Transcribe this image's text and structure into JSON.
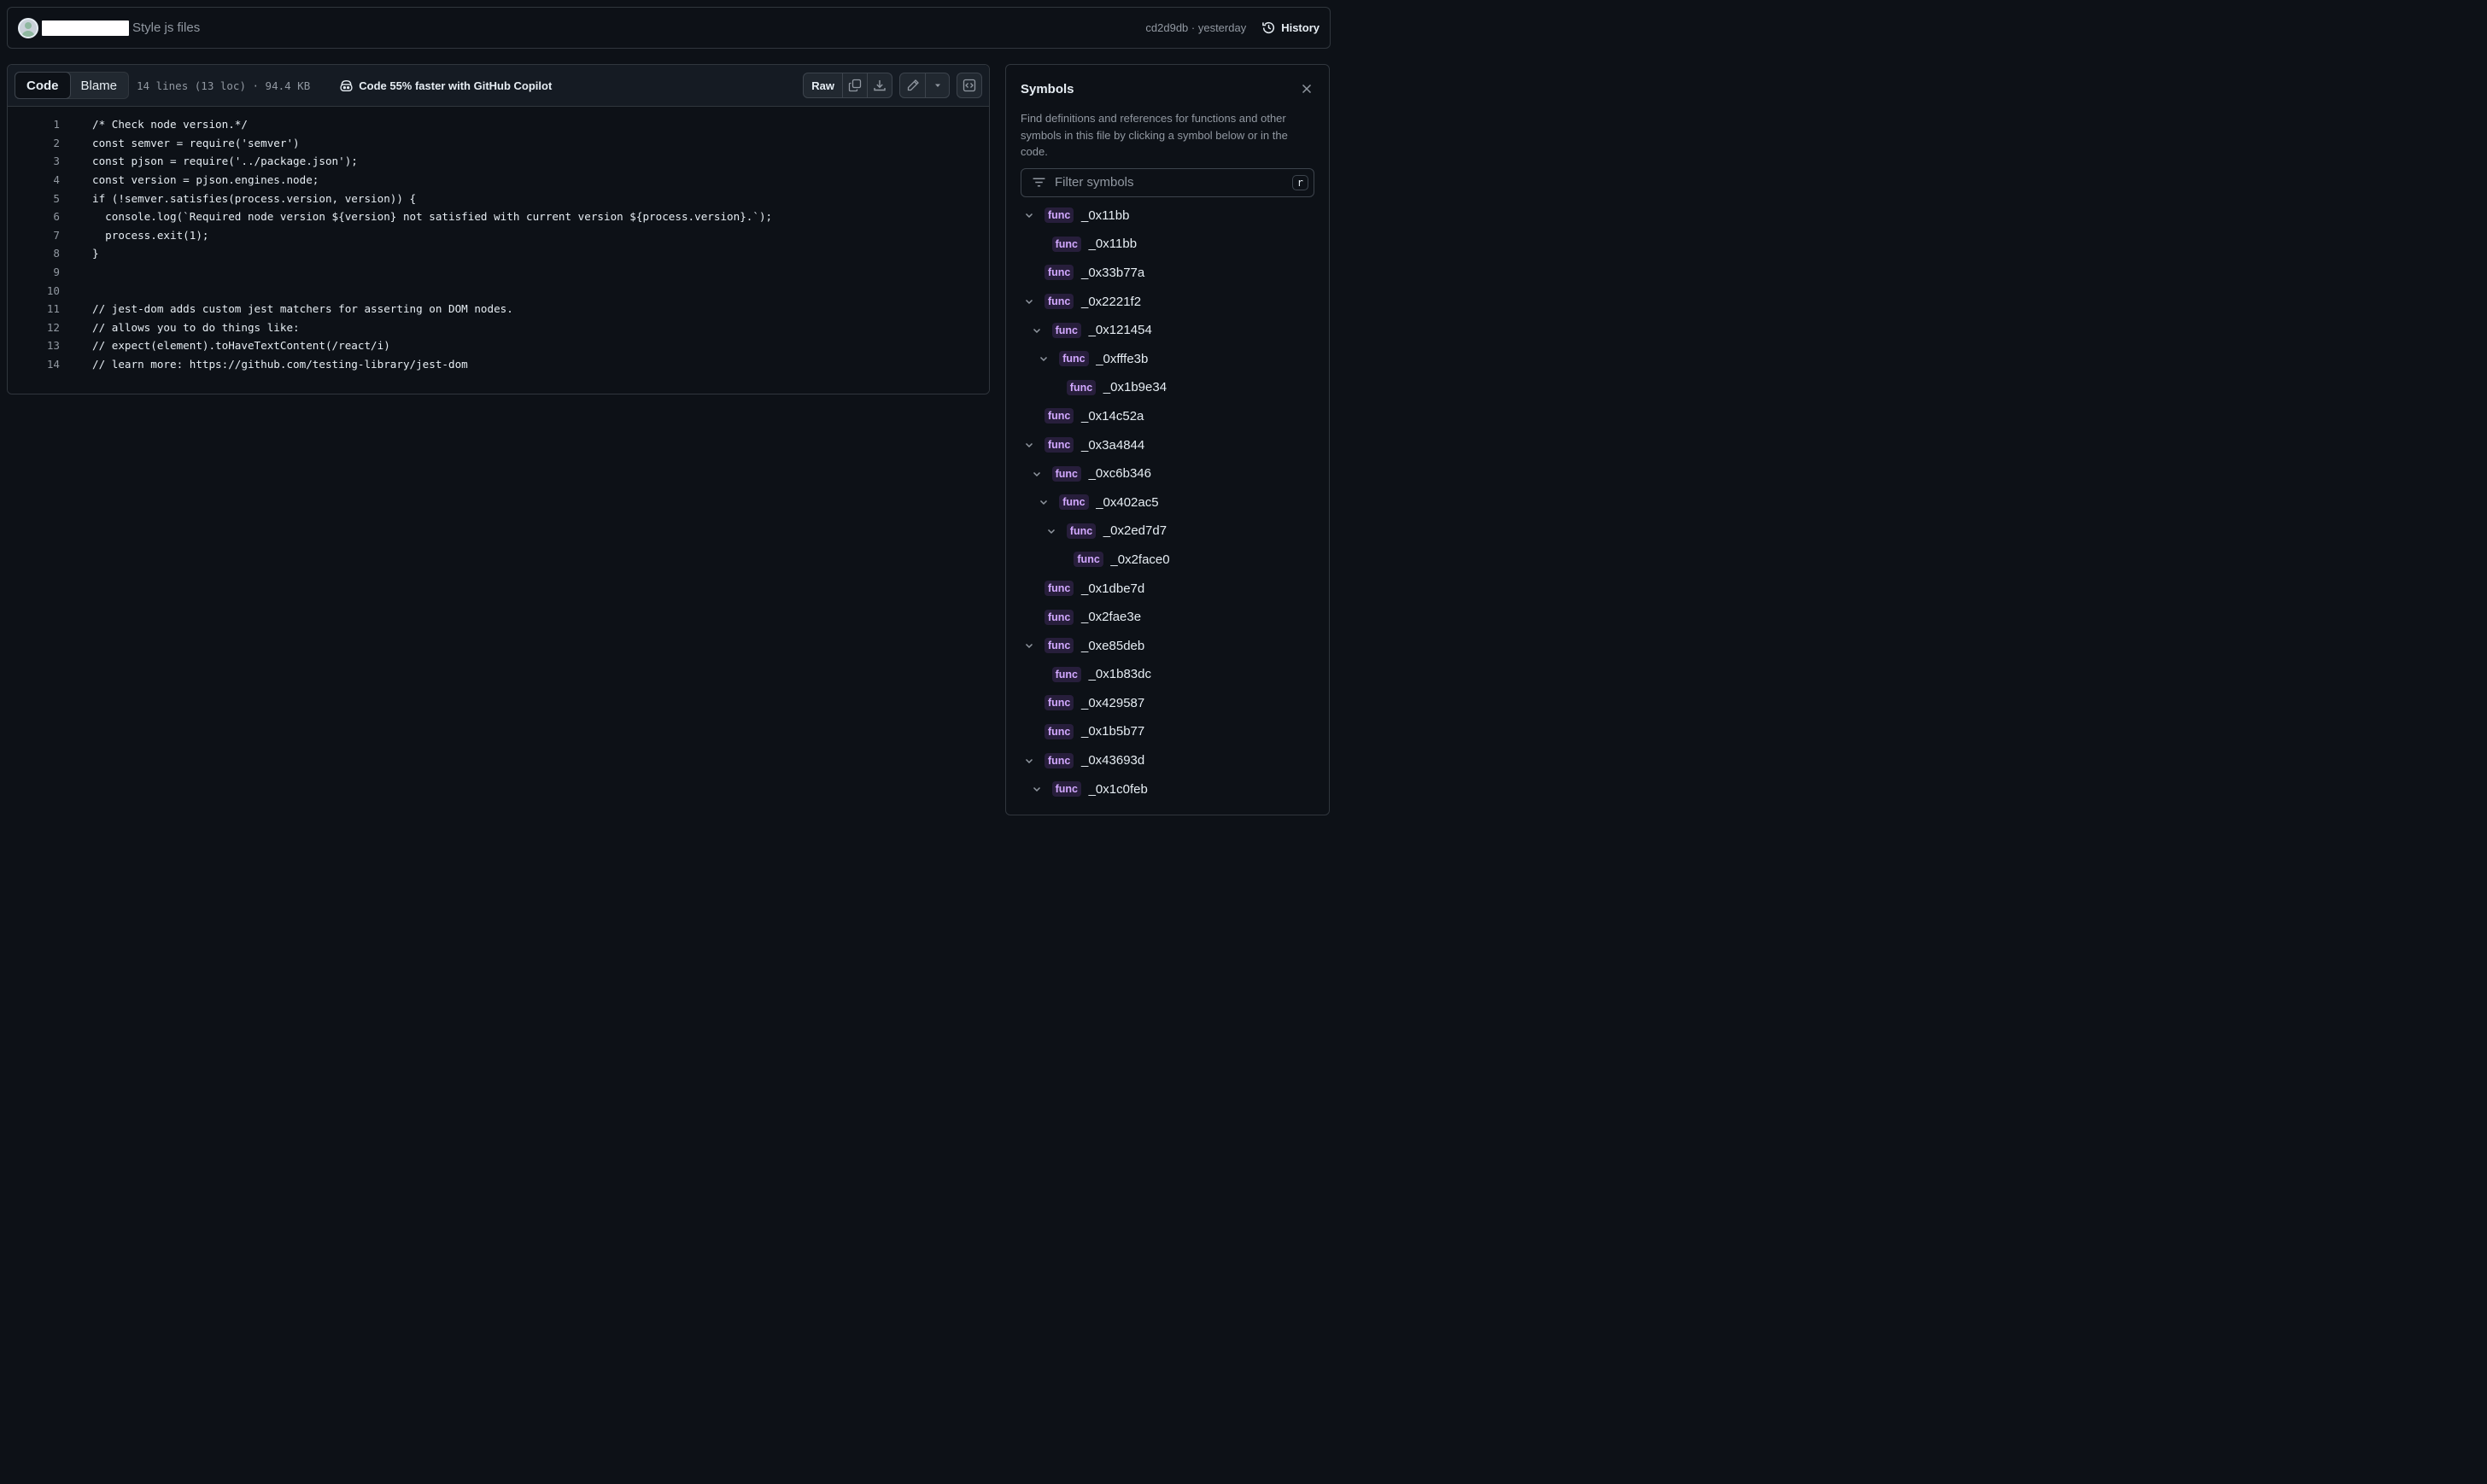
{
  "commit": {
    "message": "Style js files",
    "hash_time": "cd2d9db · yesterday",
    "history_label": "History"
  },
  "file": {
    "tabs": [
      "Code",
      "Blame"
    ],
    "active_tab": "Code",
    "meta": "14 lines (13 loc) · 94.4 KB",
    "copilot_text": "Code 55% faster with GitHub Copilot",
    "raw_label": "Raw",
    "lines": [
      {
        "n": "1",
        "code": "/* Check node version.*/"
      },
      {
        "n": "2",
        "code": "const semver = require('semver')"
      },
      {
        "n": "3",
        "code": "const pjson = require('../package.json');"
      },
      {
        "n": "4",
        "code": "const version = pjson.engines.node;"
      },
      {
        "n": "5",
        "code": "if (!semver.satisfies(process.version, version)) {"
      },
      {
        "n": "6",
        "code": "  console.log(`Required node version ${version} not satisfied with current version ${process.version}.`);"
      },
      {
        "n": "7",
        "code": "  process.exit(1);"
      },
      {
        "n": "8",
        "code": "}"
      },
      {
        "n": "9",
        "code": ""
      },
      {
        "n": "10",
        "code": ""
      },
      {
        "n": "11",
        "code": "// jest-dom adds custom jest matchers for asserting on DOM nodes."
      },
      {
        "n": "12",
        "code": "// allows you to do things like:"
      },
      {
        "n": "13",
        "code": "// expect(element).toHaveTextContent(/react/i)"
      },
      {
        "n": "14",
        "code": "// learn more: https://github.com/testing-library/jest-dom"
      }
    ]
  },
  "symbols": {
    "title": "Symbols",
    "description": "Find definitions and references for functions and other symbols in this file by clicking a symbol below or in the code.",
    "filter_placeholder": "Filter symbols",
    "filter_shortcut": "r",
    "badge": "func",
    "items": [
      {
        "name": "_0x11bb",
        "depth": 0,
        "expanded": true
      },
      {
        "name": "_0x11bb",
        "depth": 1,
        "expanded": false
      },
      {
        "name": "_0x33b77a",
        "depth": 0,
        "expanded": false
      },
      {
        "name": "_0x2221f2",
        "depth": 0,
        "expanded": true
      },
      {
        "name": "_0x121454",
        "depth": 1,
        "expanded": true
      },
      {
        "name": "_0xfffe3b",
        "depth": 2,
        "expanded": true
      },
      {
        "name": "_0x1b9e34",
        "depth": 3,
        "expanded": false
      },
      {
        "name": "_0x14c52a",
        "depth": 0,
        "expanded": false
      },
      {
        "name": "_0x3a4844",
        "depth": 0,
        "expanded": true
      },
      {
        "name": "_0xc6b346",
        "depth": 1,
        "expanded": true
      },
      {
        "name": "_0x402ac5",
        "depth": 2,
        "expanded": true
      },
      {
        "name": "_0x2ed7d7",
        "depth": 3,
        "expanded": true
      },
      {
        "name": "_0x2face0",
        "depth": 4,
        "expanded": false
      },
      {
        "name": "_0x1dbe7d",
        "depth": 0,
        "expanded": false
      },
      {
        "name": "_0x2fae3e",
        "depth": 0,
        "expanded": false
      },
      {
        "name": "_0xe85deb",
        "depth": 0,
        "expanded": true
      },
      {
        "name": "_0x1b83dc",
        "depth": 1,
        "expanded": false
      },
      {
        "name": "_0x429587",
        "depth": 0,
        "expanded": false
      },
      {
        "name": "_0x1b5b77",
        "depth": 0,
        "expanded": false
      },
      {
        "name": "_0x43693d",
        "depth": 0,
        "expanded": true
      },
      {
        "name": "_0x1c0feb",
        "depth": 1,
        "expanded": true
      }
    ]
  },
  "colors": {
    "background": "#0d1117",
    "border": "#30363d",
    "text": "#e6edf3",
    "muted": "#9198a1",
    "func_badge_bg": "#271e3b",
    "func_badge_text": "#d2a8ff"
  }
}
